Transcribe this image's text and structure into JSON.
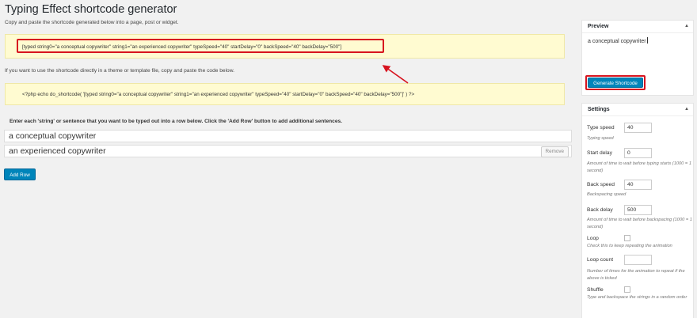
{
  "page": {
    "title": "Typing Effect shortcode generator",
    "intro": "Copy and paste the shortcode generated below into a page, post or widget.",
    "shortcode": "[typed string0=\"a conceptual copywriter\" string1=\"an experienced copywriter\" typeSpeed=\"40\" startDelay=\"0\" backSpeed=\"40\" backDelay=\"500\"]",
    "template_note": "If you want to use the shortcode directly in a theme or template file, copy and paste the code below.",
    "php_code": "<?php echo do_shortcode( '[typed string0=\"a conceptual copywriter\" string1=\"an experienced copywriter\" typeSpeed=\"40\" startDelay=\"0\" backSpeed=\"40\" backDelay=\"500\"]' ) ?>",
    "rows_heading": "Enter each 'string' or sentence that you want to be typed out into a row below. Click the 'Add Row' button to add additional sentences.",
    "rows": [
      {
        "value": "a conceptual copywriter"
      },
      {
        "value": "an experienced copywriter",
        "remove_label": "Remove"
      }
    ],
    "add_row_label": "Add Row"
  },
  "preview": {
    "title": "Preview",
    "toggle_icon": "▲",
    "text": "a conceptual copywriter",
    "generate_label": "Generate Shortcode"
  },
  "settings": {
    "title": "Settings",
    "toggle_icon": "▲",
    "type_speed": {
      "label": "Type speed",
      "value": "40",
      "desc": "Typing speed"
    },
    "start_delay": {
      "label": "Start delay",
      "value": "0",
      "desc": "Amount of time to wait before typing starts (1000 = 1 second)"
    },
    "back_speed": {
      "label": "Back speed",
      "value": "40",
      "desc": "Backspacing speed"
    },
    "back_delay": {
      "label": "Back delay",
      "value": "500",
      "desc": "Amount of time to wait before backspacing (1000 = 1 second)"
    },
    "loop": {
      "label": "Loop",
      "checked": false,
      "desc": "Check this to keep repeating the animation"
    },
    "loop_count": {
      "label": "Loop count",
      "value": "",
      "desc": "Number of times for the animation to repeat if the above is ticked"
    },
    "shuffle": {
      "label": "Shuffle",
      "checked": false,
      "desc": "Type and backspace the strings in a random order"
    }
  },
  "colors": {
    "primary_button": "#0085ba",
    "highlight": "#d7141f",
    "code_background": "#fffbd1"
  }
}
